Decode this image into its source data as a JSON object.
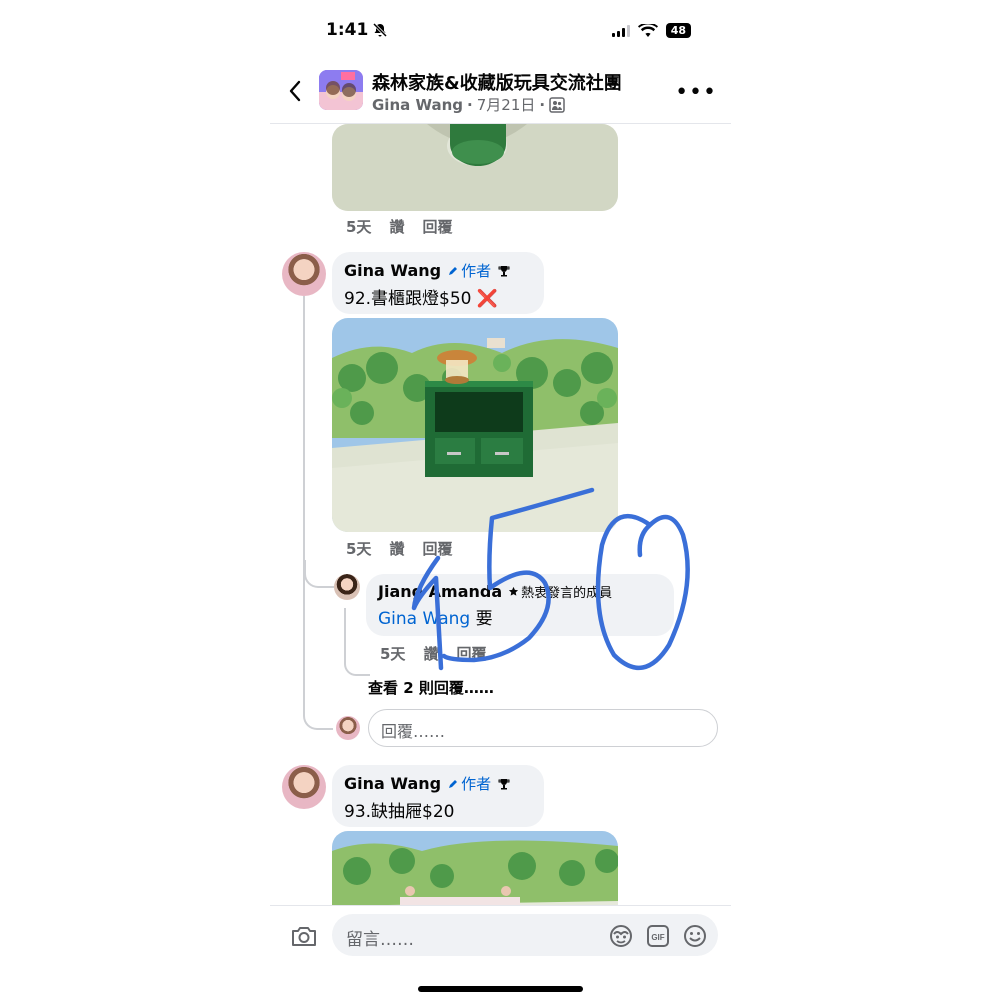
{
  "status_bar": {
    "time": "1:41",
    "battery": "48"
  },
  "header": {
    "title": "森林家族&收藏版玩具交流社團",
    "author": "Gina Wang",
    "date": "7月21日"
  },
  "top_image_actions": {
    "time": "5天",
    "like": "讚",
    "reply": "回覆"
  },
  "comment_92": {
    "author": "Gina Wang",
    "author_tag": "作者",
    "text": "92.書櫃跟燈$50",
    "mark": "❌",
    "actions": {
      "time": "5天",
      "like": "讚",
      "reply": "回覆"
    }
  },
  "reply_jiang": {
    "author": "Jiang Amanda",
    "badge": "熱衷發言的成員",
    "mention": "Gina Wang",
    "text": " 要",
    "actions": {
      "time": "5天",
      "like": "讚",
      "reply": "回覆"
    }
  },
  "view_more_replies": "查看 2 則回覆……",
  "reply_placeholder": "回覆……",
  "comment_93": {
    "author": "Gina Wang",
    "author_tag": "作者",
    "text": "93.缺抽屜$20"
  },
  "comment_box": {
    "placeholder": "留言……"
  },
  "handwriting": {
    "text": "150",
    "color": "#3a6fd8"
  },
  "colors": {
    "accent": "#0064d1",
    "bubble": "#f0f2f5",
    "secondary_text": "#65676b"
  }
}
